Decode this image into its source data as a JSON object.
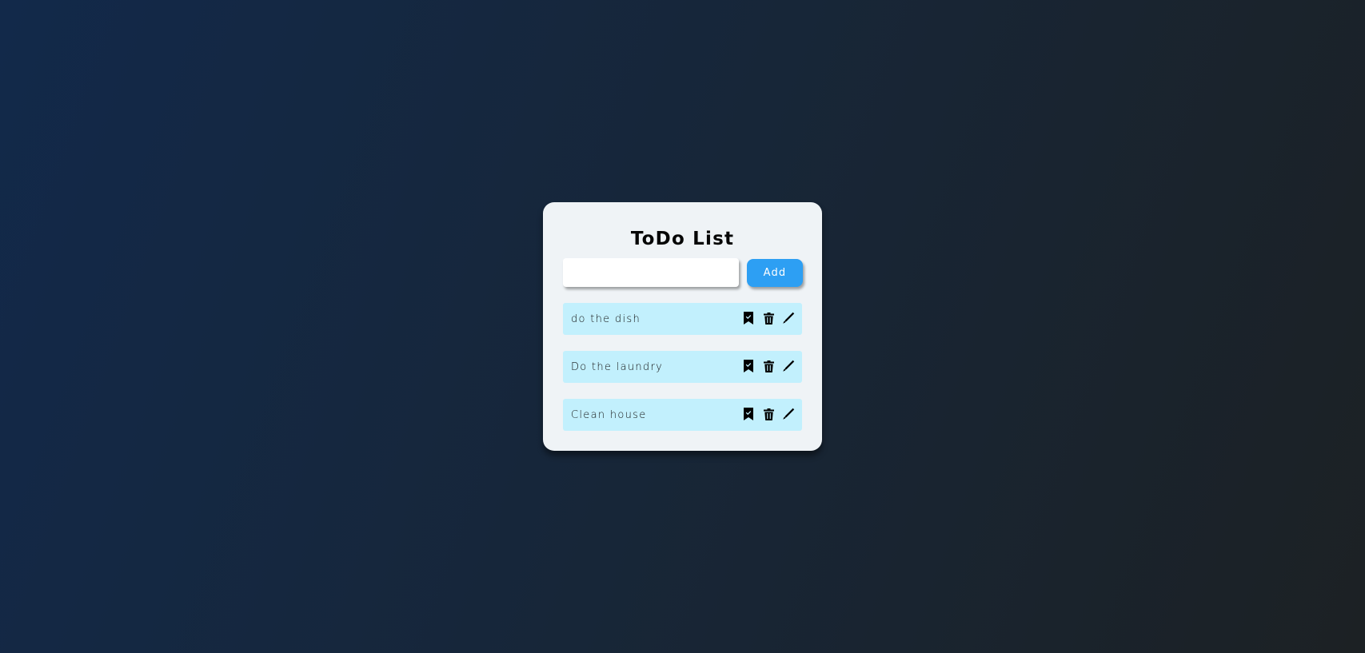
{
  "app": {
    "title": "ToDo List"
  },
  "input": {
    "value": "",
    "placeholder": ""
  },
  "add_button": {
    "label": "Add"
  },
  "tasks": [
    {
      "text": "do the dish",
      "icons": [
        "bookmark-check-icon",
        "trash-icon",
        "pencil-icon"
      ]
    },
    {
      "text": "Do the laundry",
      "icons": [
        "bookmark-check-icon",
        "trash-icon",
        "pencil-icon"
      ]
    },
    {
      "text": "Clean house",
      "icons": [
        "bookmark-check-icon",
        "trash-icon",
        "pencil-icon"
      ]
    }
  ],
  "colors": {
    "background_start": "#12294a",
    "background_end": "#1c2124",
    "card": "#eff3f6",
    "accent": "#2d9ff3",
    "task_background": "#c2f0fd",
    "icon": "#000000"
  }
}
